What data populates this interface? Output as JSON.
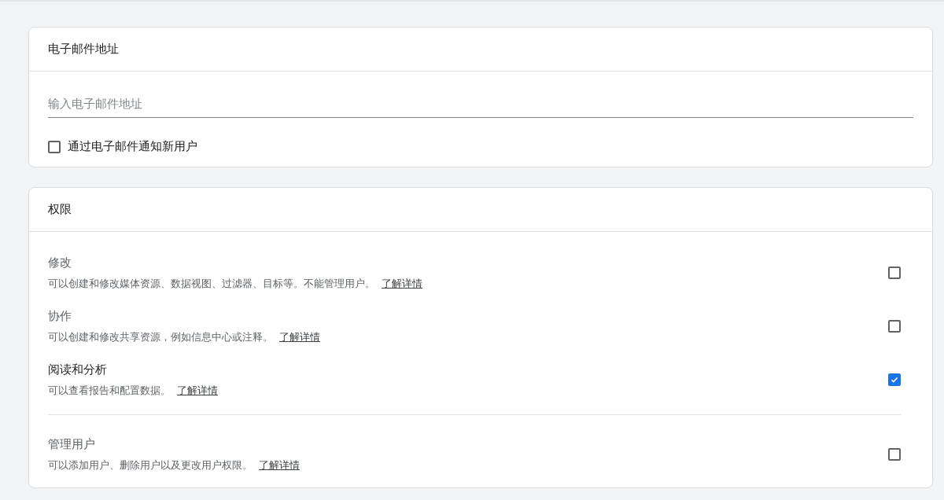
{
  "email_card": {
    "title": "电子邮件地址",
    "field": {
      "placeholder": "输入电子邮件地址"
    },
    "notify": {
      "label": "通过电子邮件通知新用户",
      "checked": false
    }
  },
  "permissions_card": {
    "title": "权限",
    "groups": [
      {
        "items": [
          {
            "title": "修改",
            "description": "可以创建和修改媒体资源、数据视图、过滤器、目标等。不能管理用户。",
            "link": "了解详情",
            "checked": false
          },
          {
            "title": "协作",
            "description": "可以创建和修改共享资源，例如信息中心或注释。",
            "link": "了解详情",
            "checked": false
          },
          {
            "title": "阅读和分析",
            "description": "可以查看报告和配置数据。",
            "link": "了解详情",
            "checked": true
          }
        ]
      },
      {
        "items": [
          {
            "title": "管理用户",
            "description": "可以添加用户、删除用户以及更改用户权限。",
            "link": "了解详情",
            "checked": false
          }
        ]
      }
    ]
  }
}
